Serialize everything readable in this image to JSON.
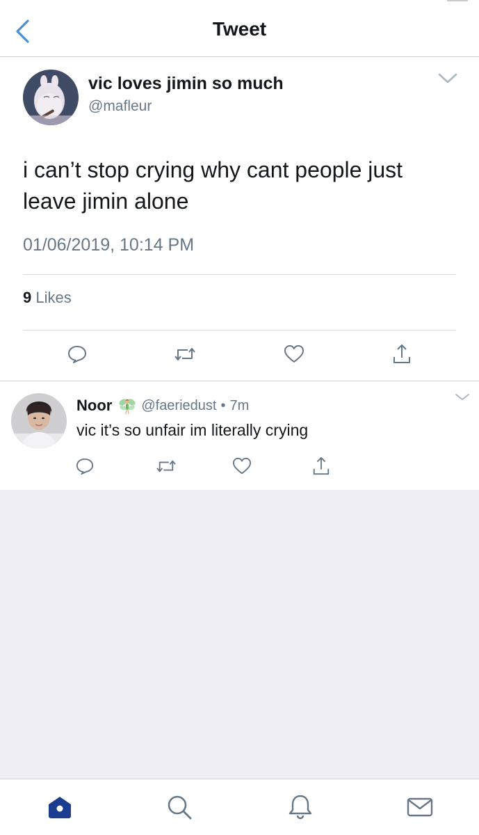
{
  "header": {
    "title": "Tweet",
    "back_icon": "chevron-left-icon",
    "accent_color": "#1da1f2"
  },
  "tweet": {
    "author_name": "vic loves jimin so much",
    "author_handle": "@mafleur",
    "text": "i can’t stop crying why cant people just leave jimin alone",
    "timestamp": "01/06/2019, 10:14 PM",
    "likes_count": "9",
    "likes_label": "Likes",
    "actions": [
      "reply-icon",
      "retweet-icon",
      "like-icon",
      "share-icon"
    ]
  },
  "reply": {
    "author_name": "Noor",
    "emoji": "fairy-emoji",
    "author_handle": "@faeriedust",
    "separator": "•",
    "time": "7m",
    "text": "vic it’s so unfair im literally crying",
    "actions": [
      "reply-icon",
      "retweet-icon",
      "like-icon",
      "share-icon"
    ]
  },
  "tabbar": {
    "items": [
      "home-icon",
      "search-icon",
      "notifications-icon",
      "messages-icon"
    ],
    "active": "home-icon",
    "active_color": "#1c3d8f"
  }
}
